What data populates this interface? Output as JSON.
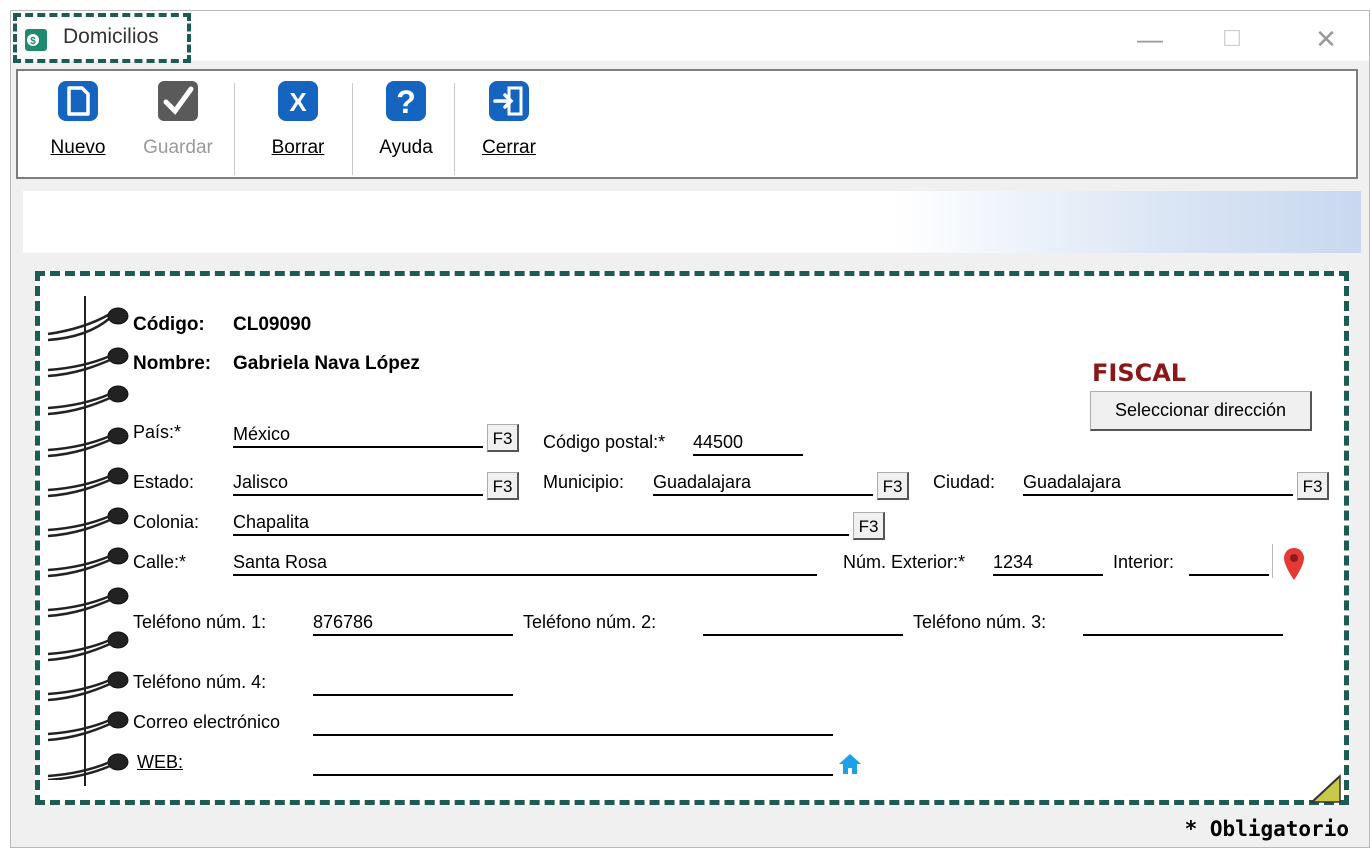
{
  "window": {
    "title": "Domicilios",
    "minimize_symbol": "—",
    "maximize_symbol": "☐",
    "close_symbol": "✕"
  },
  "toolbar": {
    "buttons": [
      {
        "label": "Nuevo",
        "icon": "new-document-icon",
        "enabled": true,
        "color": "#1565c0"
      },
      {
        "label": "Guardar",
        "icon": "checkmark-icon",
        "enabled": false,
        "color": "#5a5a5a"
      },
      {
        "label": "Borrar",
        "icon": "delete-x-icon",
        "enabled": true,
        "color": "#1565c0"
      },
      {
        "label": "Ayuda",
        "icon": "help-icon",
        "enabled": true,
        "color": "#1565c0"
      },
      {
        "label": "Cerrar",
        "icon": "exit-door-icon",
        "enabled": true,
        "color": "#1565c0"
      }
    ]
  },
  "form": {
    "codigo_label": "Código:",
    "codigo_value": "CL09090",
    "nombre_label": "Nombre:",
    "nombre_value": "Gabriela Nava López",
    "fiscal_label": "FISCAL",
    "select_address_button": "Seleccionar dirección",
    "pais_label": "País:*",
    "pais_value": "México",
    "cp_label": "Código postal:*",
    "cp_value": "44500",
    "estado_label": "Estado:",
    "estado_value": "Jalisco",
    "municipio_label": "Municipio:",
    "municipio_value": "Guadalajara",
    "ciudad_label": "Ciudad:",
    "ciudad_value": "Guadalajara",
    "colonia_label": "Colonia:",
    "colonia_value": "Chapalita",
    "calle_label": "Calle:*",
    "calle_value": "Santa Rosa",
    "num_ext_label": "Núm. Exterior:*",
    "num_ext_value": "1234",
    "interior_label": "Interior:",
    "interior_value": "",
    "tel1_label": "Teléfono núm. 1:",
    "tel1_value": "876786",
    "tel2_label": "Teléfono núm. 2:",
    "tel2_value": "",
    "tel3_label": "Teléfono núm. 3:",
    "tel3_value": "",
    "tel4_label": "Teléfono núm. 4:",
    "tel4_value": "",
    "correo_label": "Correo electrónico",
    "correo_value": "",
    "web_label": "WEB:",
    "web_value": "",
    "f3_label": "F3"
  },
  "footer": {
    "required_note": "* Obligatorio"
  },
  "colors": {
    "accent_blue": "#1565c0",
    "fiscal_red": "#8a1818",
    "highlight_border": "#1d5c52",
    "map_pin": "#e53935",
    "home_icon": "#1ea0e6"
  }
}
